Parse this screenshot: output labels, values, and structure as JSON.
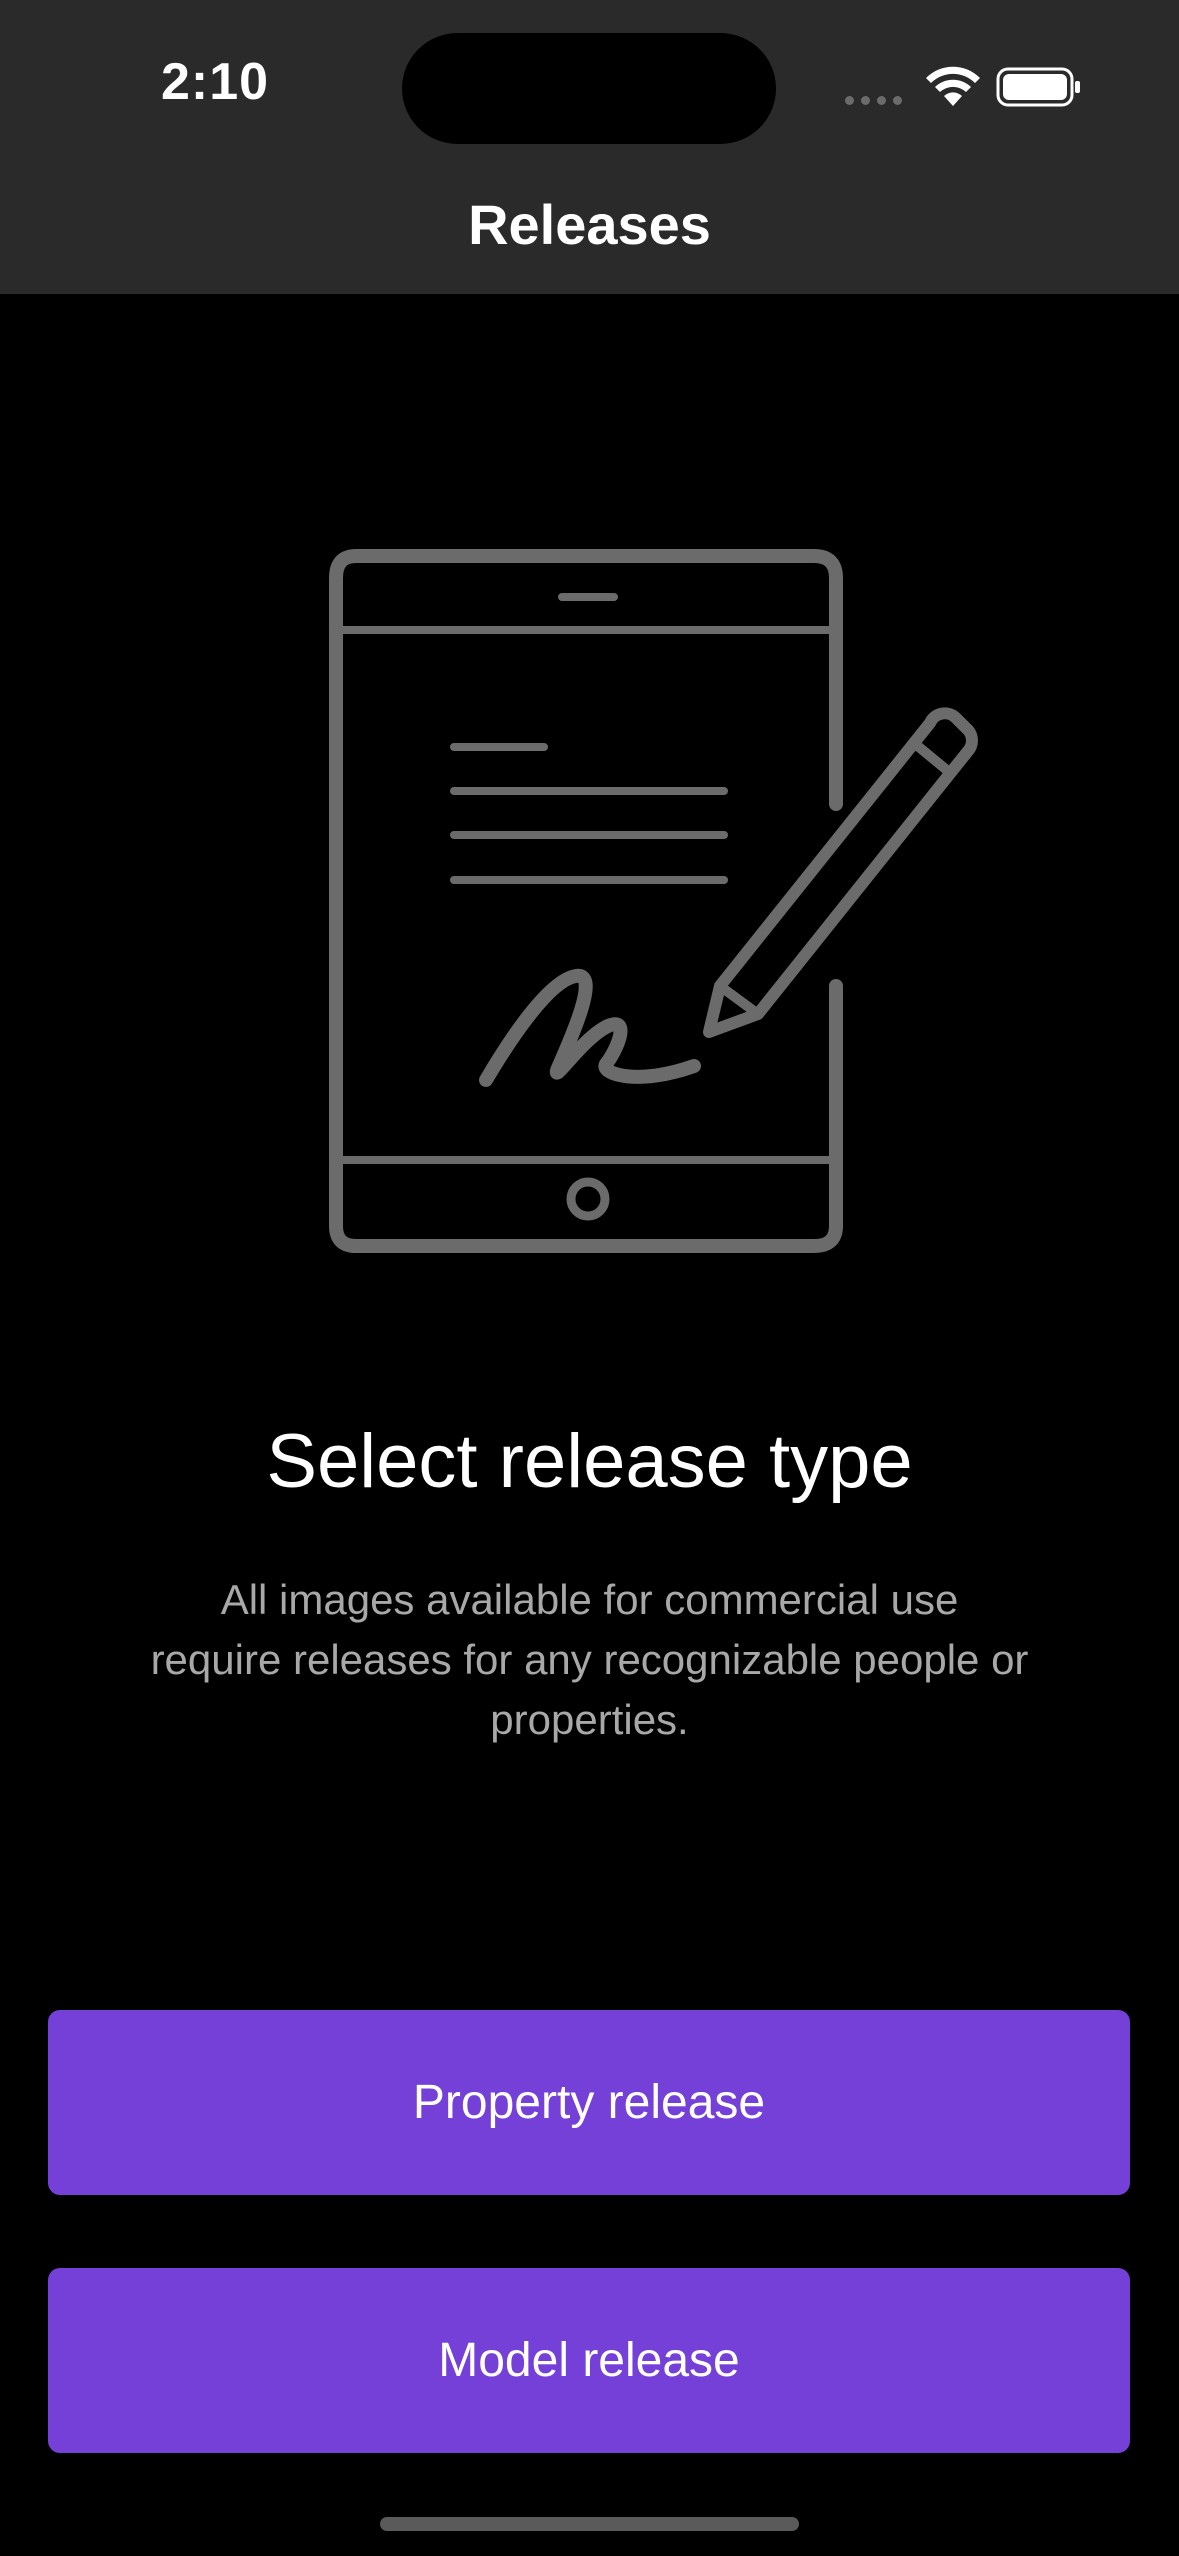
{
  "status_bar": {
    "time": "2:10"
  },
  "nav": {
    "title": "Releases"
  },
  "main": {
    "illustration_icon": "tablet-signature-icon",
    "headline": "Select release type",
    "description": "All images available for commercial use require releases for any recognizable people or properties."
  },
  "actions": {
    "property_release_label": "Property release",
    "model_release_label": "Model release"
  },
  "colors": {
    "header_bg": "#2a2a2a",
    "background": "#000000",
    "accent": "#7540d8",
    "illustration_stroke": "#6b6b6b",
    "description_text": "#a8a8a8"
  }
}
